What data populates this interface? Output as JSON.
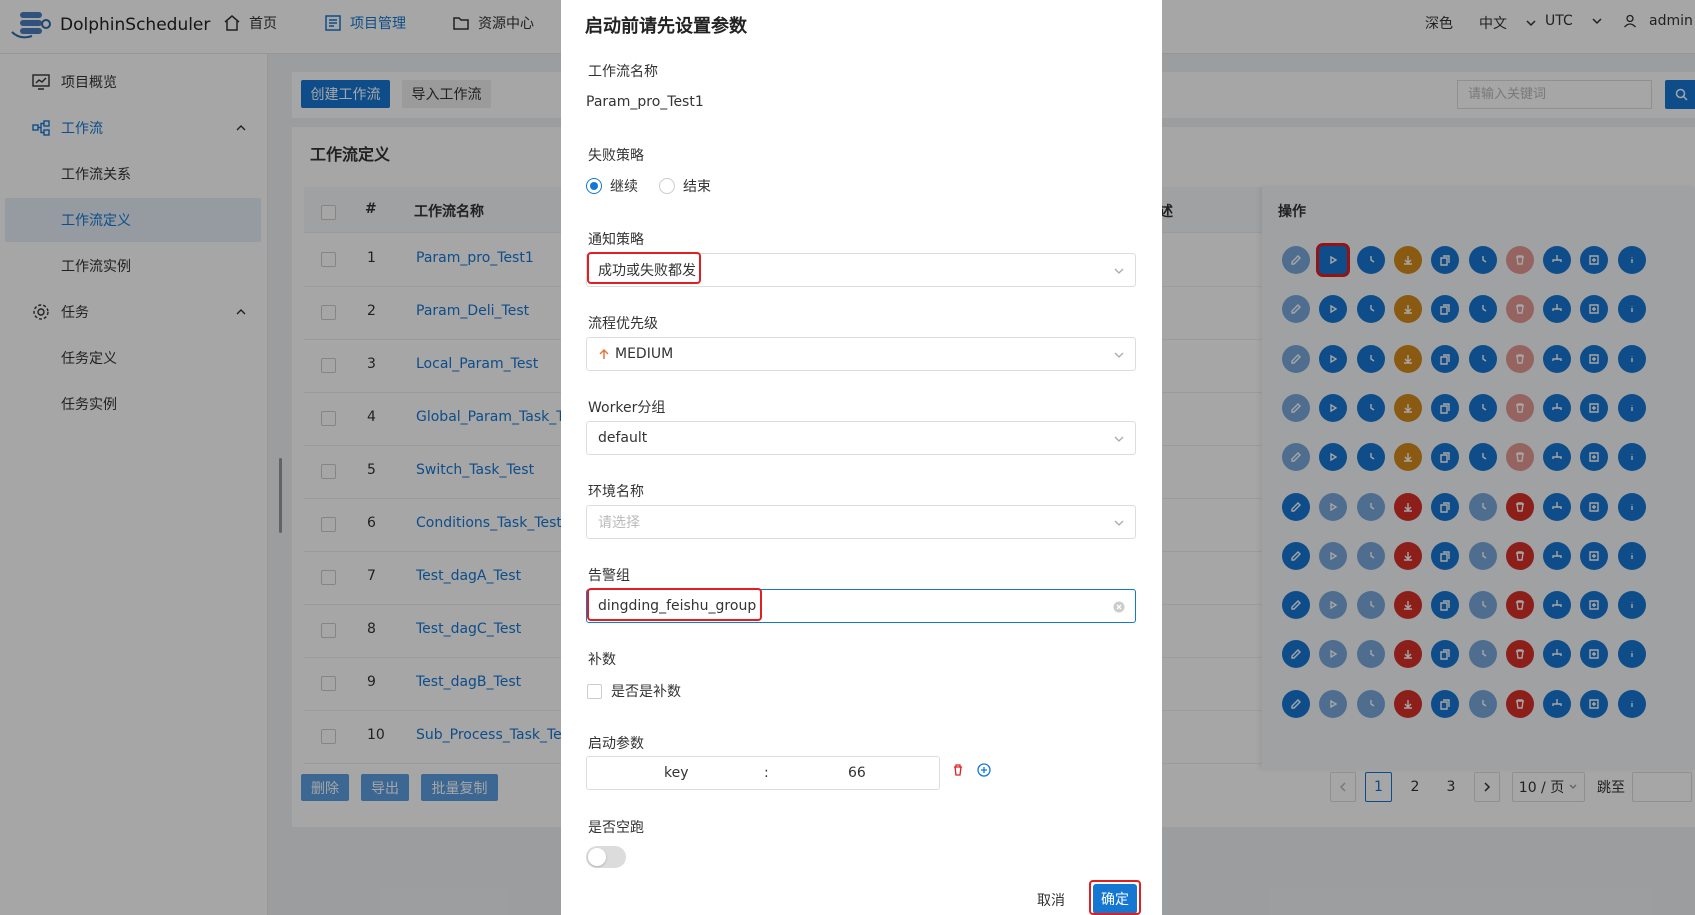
{
  "app": {
    "name": "DolphinScheduler"
  },
  "topnav": {
    "items": [
      {
        "label": "首页",
        "icon": "home-icon"
      },
      {
        "label": "项目管理",
        "icon": "project-icon"
      },
      {
        "label": "资源中心",
        "icon": "folder-icon"
      }
    ],
    "theme": "深色",
    "language": "中文",
    "timezone": "UTC",
    "user": "admin"
  },
  "sidebar": {
    "items": [
      {
        "label": "项目概览"
      },
      {
        "label": "工作流"
      },
      {
        "label": "工作流关系"
      },
      {
        "label": "工作流定义"
      },
      {
        "label": "工作流实例"
      },
      {
        "label": "任务"
      },
      {
        "label": "任务定义"
      },
      {
        "label": "任务实例"
      }
    ]
  },
  "toolbar": {
    "create_label": "创建工作流",
    "import_label": "导入工作流",
    "search_placeholder": "请输入关键词"
  },
  "table": {
    "title": "工作流定义",
    "headers": {
      "index": "#",
      "name": "工作流名称",
      "desc_fragment": "述",
      "ops": "操作"
    },
    "rows": [
      {
        "idx": "1",
        "name": "Param_pro_Test1"
      },
      {
        "idx": "2",
        "name": "Param_Deli_Test"
      },
      {
        "idx": "3",
        "name": "Local_Param_Test"
      },
      {
        "idx": "4",
        "name": "Global_Param_Task_Te"
      },
      {
        "idx": "5",
        "name": "Switch_Task_Test"
      },
      {
        "idx": "6",
        "name": "Conditions_Task_Test"
      },
      {
        "idx": "7",
        "name": "Test_dagA_Test"
      },
      {
        "idx": "8",
        "name": "Test_dagC_Test"
      },
      {
        "idx": "9",
        "name": "Test_dagB_Test"
      },
      {
        "idx": "10",
        "name": "Sub_Process_Task_Tes"
      }
    ]
  },
  "footer": {
    "delete_label": "删除",
    "export_label": "导出",
    "batch_copy_label": "批量复制",
    "pages": [
      "1",
      "2",
      "3"
    ],
    "page_size": "10 / 页",
    "jump_label": "跳至"
  },
  "modal": {
    "title": "启动前请先设置参数",
    "workflow_name_label": "工作流名称",
    "workflow_name_value": "Param_pro_Test1",
    "failure_strategy_label": "失败策略",
    "failure_options": [
      "继续",
      "结束"
    ],
    "notify_strategy_label": "通知策略",
    "notify_strategy_value": "成功或失败都发",
    "priority_label": "流程优先级",
    "priority_value": "MEDIUM",
    "worker_group_label": "Worker分组",
    "worker_group_value": "default",
    "env_label": "环境名称",
    "env_placeholder": "请选择",
    "alert_group_label": "告警组",
    "alert_group_value": "dingding_feishu_group",
    "complement_label": "补数",
    "complement_checkbox": "是否是补数",
    "start_params_label": "启动参数",
    "param_key": "key",
    "param_sep": ":",
    "param_value": "66",
    "dry_run_label": "是否空跑",
    "cancel_label": "取消",
    "confirm_label": "确定"
  },
  "colors": {
    "primary": "#1677d3",
    "orange": "#d48a1e",
    "red": "#d9302a",
    "highlight": "#e02020"
  }
}
